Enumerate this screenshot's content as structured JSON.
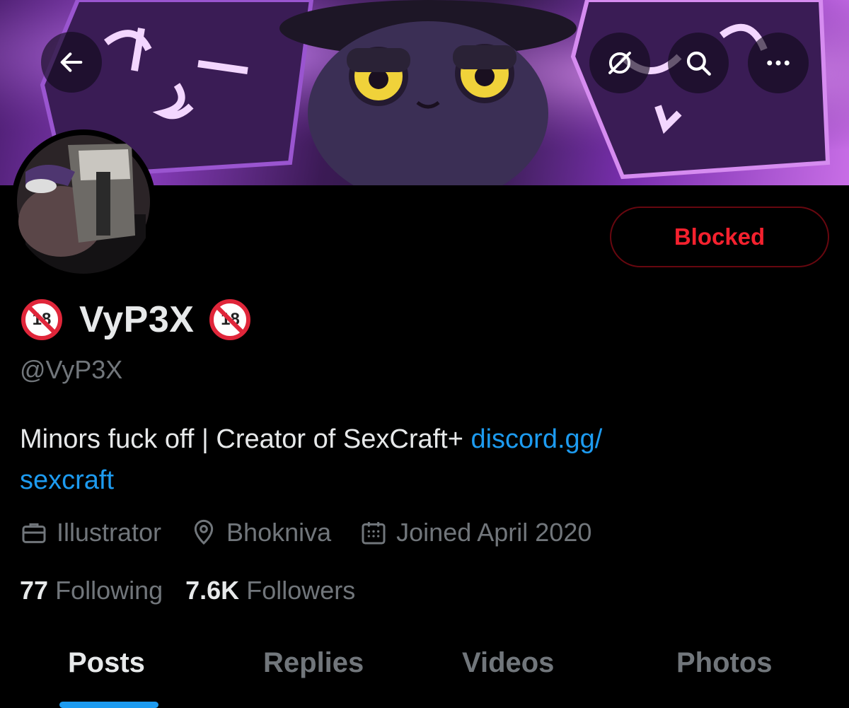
{
  "header": {
    "back_icon": "arrow-left-icon",
    "grok_icon": "grok-icon",
    "search_icon": "search-icon",
    "more_icon": "more-horizontal-icon"
  },
  "profile": {
    "display_name": "VyP3X",
    "name_badge_emoji": "🔞",
    "handle": "@VyP3X",
    "bio_text": "Minors fuck off | Creator of SexCraft+ ",
    "bio_link_line1": "discord.gg/",
    "bio_link_line2": "sexcraft",
    "action_button": "Blocked"
  },
  "meta": {
    "profession": "Illustrator",
    "location": "Bhokniva",
    "joined": "Joined April 2020"
  },
  "stats": {
    "following_count": "77",
    "following_label": "Following",
    "followers_count": "7.6K",
    "followers_label": "Followers"
  },
  "tabs": [
    {
      "label": "Posts",
      "active": true
    },
    {
      "label": "Replies",
      "active": false
    },
    {
      "label": "Videos",
      "active": false
    },
    {
      "label": "Photos",
      "active": false
    }
  ],
  "colors": {
    "accent": "#1d9bf0",
    "blocked_red": "#f4212e",
    "muted": "#71767b",
    "background": "#000000"
  }
}
